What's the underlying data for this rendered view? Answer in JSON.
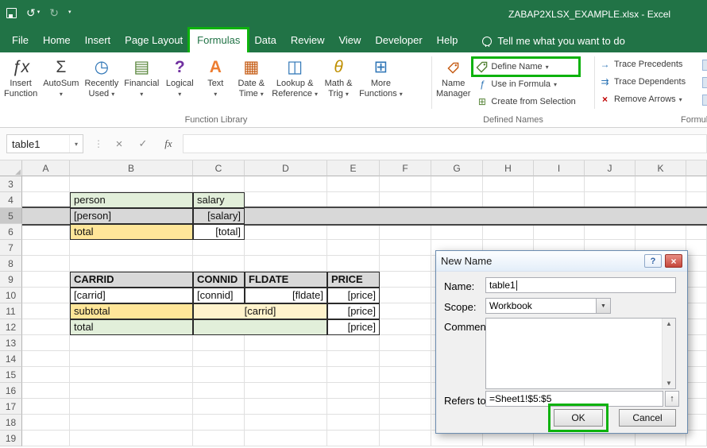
{
  "title_bar": {
    "title": "ZABAP2XLSX_EXAMPLE.xlsx - Excel"
  },
  "quick_access": {
    "icons": [
      "save",
      "undo",
      "redo",
      "customize-quick-access"
    ]
  },
  "tabs": {
    "items": [
      "File",
      "Home",
      "Insert",
      "Page Layout",
      "Formulas",
      "Data",
      "Review",
      "View",
      "Developer",
      "Help"
    ],
    "selected": "Formulas",
    "tell_me": "Tell me what you want to do"
  },
  "ribbon": {
    "function_library": {
      "label": "Function Library",
      "buttons": [
        {
          "name": "insert-function",
          "icon": "fx",
          "line1": "Insert",
          "line2": "Function",
          "dropdown": false
        },
        {
          "name": "autosum",
          "icon": "sigma",
          "line1": "AutoSum",
          "line2": "",
          "dropdown": true
        },
        {
          "name": "recently-used",
          "icon": "clock",
          "line1": "Recently",
          "line2": "Used",
          "dropdown": true
        },
        {
          "name": "financial",
          "icon": "financial",
          "line1": "Financial",
          "line2": "",
          "dropdown": true
        },
        {
          "name": "logical",
          "icon": "logical",
          "line1": "Logical",
          "line2": "",
          "dropdown": true
        },
        {
          "name": "text",
          "icon": "text",
          "line1": "Text",
          "line2": "",
          "dropdown": true
        },
        {
          "name": "date-time",
          "icon": "calendar",
          "line1": "Date &",
          "line2": "Time",
          "dropdown": true
        },
        {
          "name": "lookup-reference",
          "icon": "lookup",
          "line1": "Lookup &",
          "line2": "Reference",
          "dropdown": true
        },
        {
          "name": "math-trig",
          "icon": "theta",
          "line1": "Math &",
          "line2": "Trig",
          "dropdown": true
        },
        {
          "name": "more-functions",
          "icon": "more",
          "line1": "More",
          "line2": "Functions",
          "dropdown": true
        }
      ]
    },
    "defined_names": {
      "label": "Defined Names",
      "name_manager": {
        "line1": "Name",
        "line2": "Manager",
        "icon": "name-manager"
      },
      "buttons": [
        {
          "name": "define-name",
          "icon": "define-tag",
          "label": "Define Name",
          "dropdown": true,
          "annotated": true
        },
        {
          "name": "use-in-formula",
          "icon": "use-in-formula",
          "label": "Use in Formula",
          "dropdown": true
        },
        {
          "name": "create-from-selection",
          "icon": "create-from-selection",
          "label": "Create from Selection",
          "dropdown": false
        }
      ]
    },
    "formula_auditing": {
      "label": "Formula Auditing",
      "buttons": [
        {
          "name": "trace-precedents",
          "icon": "trace-precedents",
          "label": "Trace Precedents",
          "dropdown": false
        },
        {
          "name": "trace-dependents",
          "icon": "trace-dependents",
          "label": "Trace Dependents",
          "dropdown": false
        },
        {
          "name": "remove-arrows",
          "icon": "remove-arrows",
          "label": "Remove Arrows",
          "dropdown": true
        }
      ]
    }
  },
  "formula_bar": {
    "name_box_value": "table1"
  },
  "grid": {
    "columns": [
      {
        "letter": "A",
        "width": 60
      },
      {
        "letter": "B",
        "width": 155
      },
      {
        "letter": "C",
        "width": 65
      },
      {
        "letter": "D",
        "width": 104
      },
      {
        "letter": "E",
        "width": 66
      },
      {
        "letter": "F",
        "width": 65
      },
      {
        "letter": "G",
        "width": 65
      },
      {
        "letter": "H",
        "width": 64
      },
      {
        "letter": "I",
        "width": 64
      },
      {
        "letter": "J",
        "width": 64
      },
      {
        "letter": "K",
        "width": 64
      },
      {
        "letter": "",
        "width": 26
      }
    ],
    "rows": [
      3,
      4,
      5,
      6,
      7,
      8,
      9,
      10,
      11,
      12,
      13,
      14,
      15,
      16,
      17,
      18,
      19
    ],
    "selected_row": 5,
    "cells": [
      {
        "col": "B",
        "row": 4,
        "text": "person",
        "fill": "green",
        "align": "left",
        "bordered": true
      },
      {
        "col": "C",
        "row": 4,
        "text": "salary",
        "fill": "green",
        "align": "left",
        "bordered": true
      },
      {
        "col": "B",
        "row": 5,
        "text": "[person]",
        "fill": "sel",
        "align": "left",
        "bordered": true
      },
      {
        "col": "C",
        "row": 5,
        "text": "[salary]",
        "fill": "sel",
        "align": "right",
        "bordered": true
      },
      {
        "col": "B",
        "row": 6,
        "text": "total",
        "fill": "yellow",
        "align": "left",
        "bordered": true
      },
      {
        "col": "C",
        "row": 6,
        "text": "[total]",
        "fill": "none",
        "align": "right",
        "bordered": true
      },
      {
        "col": "B",
        "row": 9,
        "text": "CARRID",
        "fill": "gray",
        "align": "left",
        "bordered": true,
        "bold": true
      },
      {
        "col": "C",
        "row": 9,
        "text": "CONNID",
        "fill": "gray",
        "align": "left",
        "bordered": true,
        "bold": true
      },
      {
        "col": "D",
        "row": 9,
        "text": "FLDATE",
        "fill": "gray",
        "align": "left",
        "bordered": true,
        "bold": true
      },
      {
        "col": "E",
        "row": 9,
        "text": "PRICE",
        "fill": "gray",
        "align": "left",
        "bordered": true,
        "bold": true
      },
      {
        "col": "B",
        "row": 10,
        "text": "[carrid]",
        "fill": "none",
        "align": "left",
        "bordered": true
      },
      {
        "col": "C",
        "row": 10,
        "text": "[connid]",
        "fill": "none",
        "align": "left",
        "bordered": true
      },
      {
        "col": "D",
        "row": 10,
        "text": "[fldate]",
        "fill": "none",
        "align": "right",
        "bordered": true
      },
      {
        "col": "E",
        "row": 10,
        "text": "[price]",
        "fill": "none",
        "align": "right",
        "bordered": true
      },
      {
        "col": "B",
        "row": 11,
        "text": "subtotal",
        "fill": "yellow",
        "align": "left",
        "bordered": true
      },
      {
        "col": "C",
        "row": 11,
        "text": "[carrid]",
        "fill": "pale_yellow",
        "align": "center",
        "bordered": true,
        "colspan": 2
      },
      {
        "col": "E",
        "row": 11,
        "text": "[price]",
        "fill": "none",
        "align": "right",
        "bordered": true
      },
      {
        "col": "B",
        "row": 12,
        "text": "total",
        "fill": "green",
        "align": "left",
        "bordered": true
      },
      {
        "col": "C",
        "row": 12,
        "text": "",
        "fill": "green",
        "align": "left",
        "bordered": true,
        "colspan": 2
      },
      {
        "col": "E",
        "row": 12,
        "text": "[price]",
        "fill": "none",
        "align": "right",
        "bordered": true
      }
    ]
  },
  "dialog": {
    "title": "New Name",
    "name_label": "Name:",
    "name_value": "table1",
    "scope_label": "Scope:",
    "scope_value": "Workbook",
    "comment_label": "Comment:",
    "refers_label": "Refers to:",
    "refers_value": "=Sheet1!$5:$5",
    "ok_label": "OK",
    "cancel_label": "Cancel"
  },
  "glyphs": {
    "dropdown": "▾",
    "select_arrow": "▼",
    "close": "×",
    "help": "?",
    "cancel_x": "×",
    "check": "✓",
    "fx": "fx",
    "dots": "⋮",
    "select_all": "◢",
    "undo": "↺",
    "redo": "↻",
    "scroll_up": "▲",
    "scroll_down": "▼",
    "range_select": "↑"
  },
  "colors": {
    "excel_green": "#217346",
    "annotation_green": "#0DB20D",
    "fill_green": "#E2EFDA",
    "fill_yellow": "#FFE699",
    "fill_pale_yellow": "#FFF3CC",
    "fill_gray": "#D9D9D9",
    "row_selection": "#D8D8D8"
  }
}
